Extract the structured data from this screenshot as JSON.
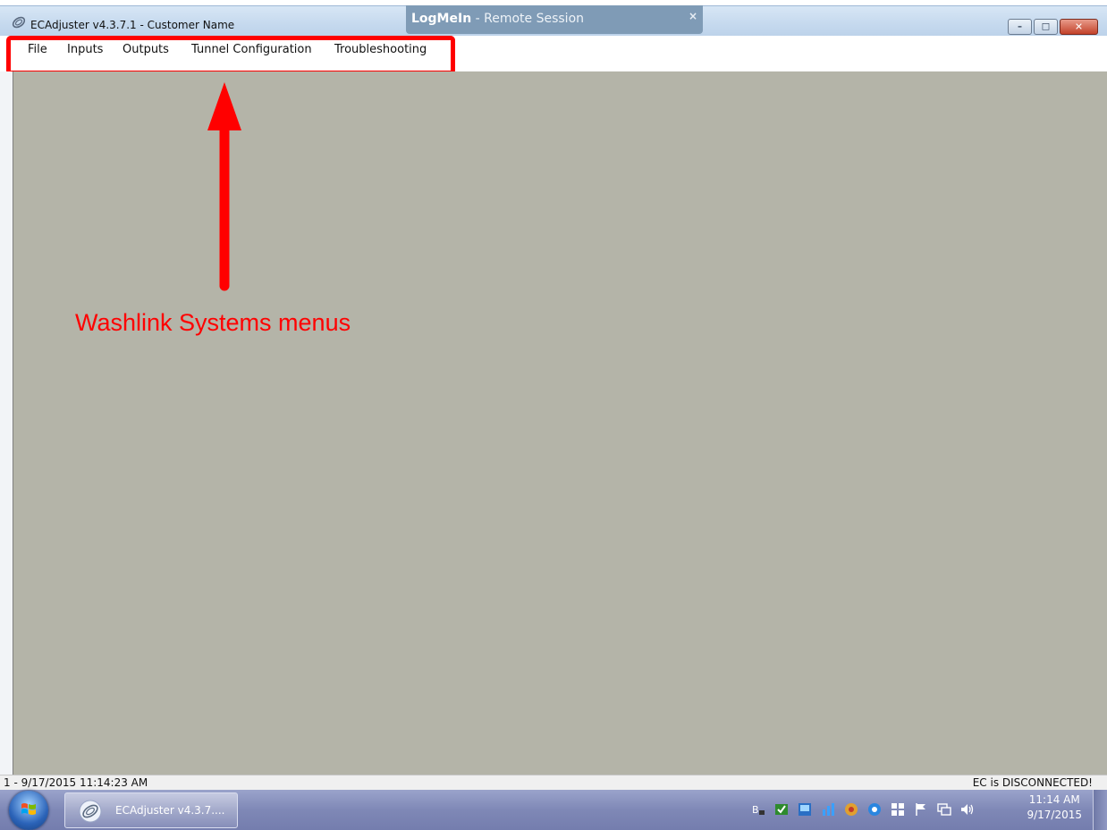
{
  "window": {
    "title": "ECAdjuster v4.3.7.1 - Customer Name",
    "controls": {
      "minimize": "–",
      "maximize": "□",
      "close": "✕"
    }
  },
  "remote_banner": {
    "brand": "LogMeIn",
    "separator": " - ",
    "label": "Remote Session",
    "close": "×"
  },
  "menu": {
    "items": [
      {
        "label": "File"
      },
      {
        "label": "Inputs"
      },
      {
        "label": "Outputs"
      },
      {
        "label": "Tunnel Configuration"
      },
      {
        "label": "Troubleshooting"
      }
    ]
  },
  "annotation": {
    "text": "Washlink Systems menus",
    "color": "#ff0000"
  },
  "status": {
    "left": "1 - 9/17/2015 11:14:23 AM",
    "right": "EC is DISCONNECTED!"
  },
  "taskbar": {
    "app_button": "ECAdjuster v4.3.7....",
    "clock_time": "11:14 AM",
    "clock_date": "9/17/2015",
    "tray_icons": [
      "keyboard-language-icon",
      "update-check-icon",
      "monitor-icon",
      "network-bars-icon",
      "security-shield-icon",
      "browser-icon",
      "app-grid-icon",
      "action-center-flag-icon",
      "network-icon",
      "volume-icon"
    ]
  },
  "colors": {
    "client_background": "#b4b4a8",
    "highlight": "#ff0000",
    "taskbar": "#7f88b6"
  }
}
